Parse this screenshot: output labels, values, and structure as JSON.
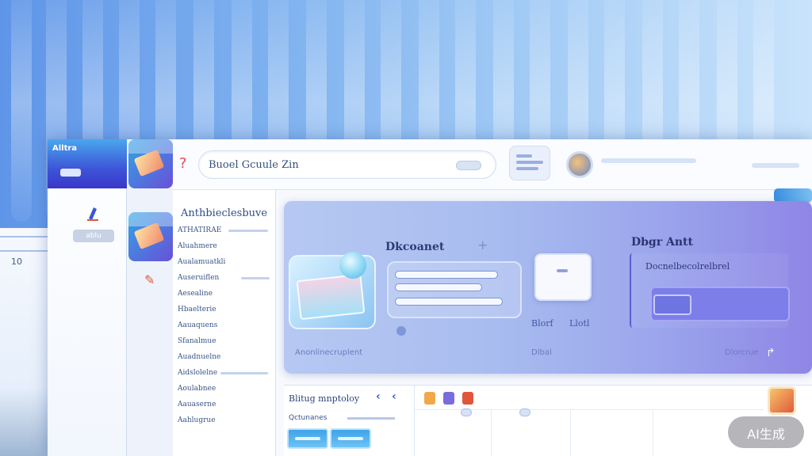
{
  "topbar": {
    "search_value": "Buoel Gcuule Zin"
  },
  "sidebar": {
    "title": "Alltra",
    "chip_label": "ablu"
  },
  "background": {
    "side_label": "10"
  },
  "list_panel": {
    "title": "Anthbieclesbuve",
    "items": [
      "ATHATIRAE",
      "Aluahmere",
      "Aualamuatkli",
      "Auseruiflen",
      "Aesealine",
      "Hbaelterie",
      "Aauaquens",
      "Sfanalmue",
      "Auadnuelne",
      "Aidslolelne",
      "Aoulabnee",
      "Aauaserne",
      "Aahlugrue"
    ]
  },
  "main_card": {
    "heading": "Dkcoanet",
    "right_heading": "Dbgr Antt",
    "right_subtitle": "Docnelbecolrelbrel",
    "card_label_left": "Blorf",
    "card_label_right": "Llotl",
    "footer_left": "Anonlinecruplent",
    "footer_mid": "Dlbal",
    "footer_right": "Dlorcrue"
  },
  "bottom_panel": {
    "label": "Blitug mnptoloy",
    "sub_label": "Qctunanes"
  },
  "watermark": {
    "text": "AI生成"
  },
  "colors": {
    "accent_blue": "#3d55d8",
    "card_violet": "#8f86e6",
    "background_sky": "#7fb2ef"
  }
}
